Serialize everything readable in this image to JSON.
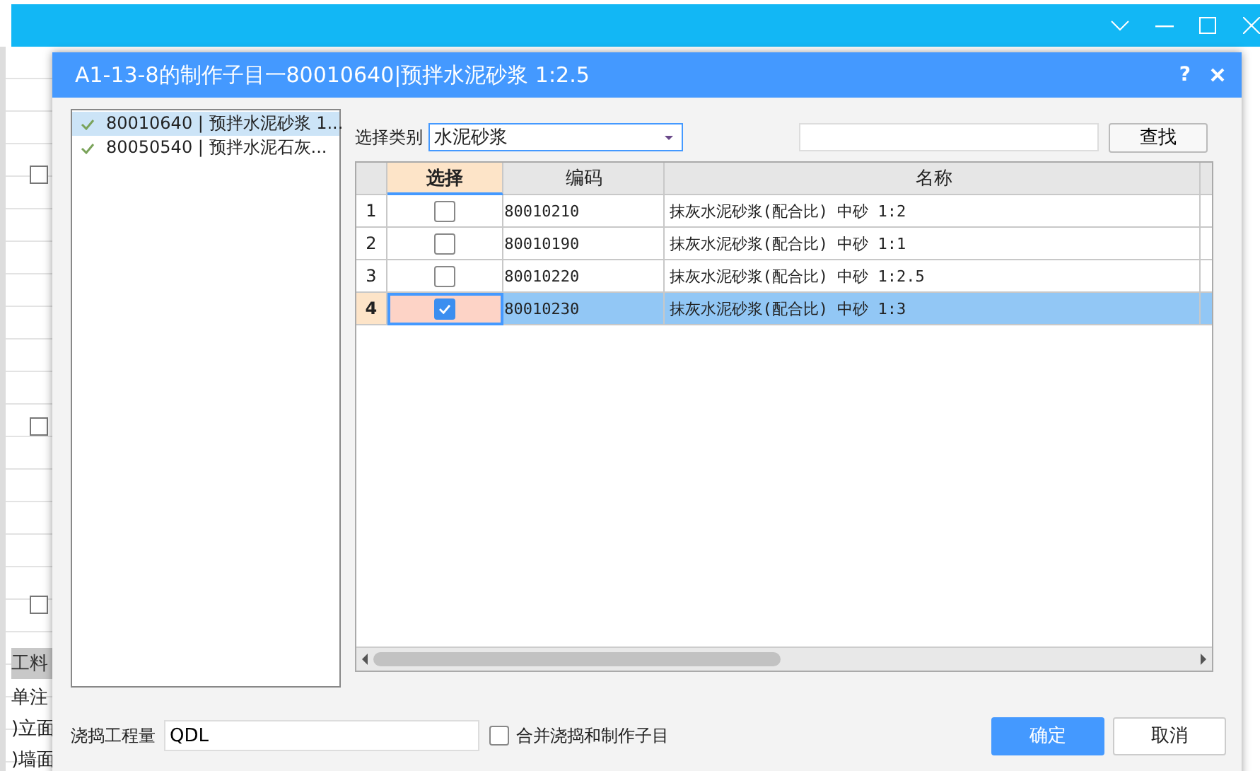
{
  "background": {
    "fragments": [
      "工料",
      "单注",
      ")立面",
      ")墙面"
    ]
  },
  "dialog": {
    "title": "A1-13-8的制作子目一80010640|预拌水泥砂浆 1:2.5",
    "help": "?"
  },
  "left_list": [
    {
      "label": "80010640 | 预拌水泥砂浆 1...",
      "checked": true,
      "selected": true
    },
    {
      "label": "80050540 | 预拌水泥石灰...",
      "checked": true,
      "selected": false
    }
  ],
  "filter": {
    "label": "选择类别",
    "value": "水泥砂浆",
    "search_button": "查找"
  },
  "table": {
    "columns": [
      "选择",
      "编码",
      "名称"
    ],
    "rows": [
      {
        "index": "1",
        "checked": false,
        "code": "80010210",
        "name": "抹灰水泥砂浆(配合比) 中砂 1:2",
        "selected": false
      },
      {
        "index": "2",
        "checked": false,
        "code": "80010190",
        "name": "抹灰水泥砂浆(配合比) 中砂 1:1",
        "selected": false
      },
      {
        "index": "3",
        "checked": false,
        "code": "80010220",
        "name": "抹灰水泥砂浆(配合比) 中砂 1:2.5",
        "selected": false
      },
      {
        "index": "4",
        "checked": true,
        "code": "80010230",
        "name": "抹灰水泥砂浆(配合比) 中砂 1:3",
        "selected": true
      }
    ]
  },
  "footer": {
    "quantity_label": "浇捣工程量",
    "quantity_value": "QDL",
    "merge_label": "合并浇捣和制作子目",
    "merge_checked": false,
    "buttons": [
      {
        "label": "确定",
        "kind": "primary"
      },
      {
        "label": "取消",
        "kind": "normal"
      }
    ]
  }
}
